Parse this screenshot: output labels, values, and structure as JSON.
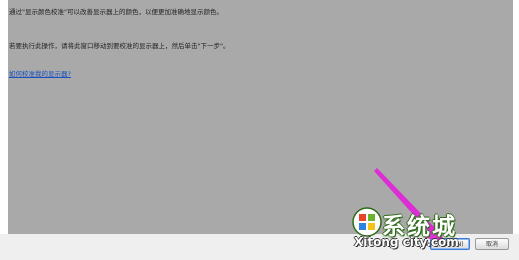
{
  "instructions": {
    "line1": "通过\"显示颜色校准\"可以改善显示器上的颜色，以便更加准确地显示颜色。",
    "line2": "若要执行此操作，请将此窗口移动到要校准的显示器上，然后单击\"下一步\"。",
    "help_link": "如何校准我的显示器?"
  },
  "buttons": {
    "next": "下一步(N)",
    "cancel": "取消"
  },
  "watermark": {
    "chinese": "系统城",
    "english": "Xitong city.com"
  },
  "colors": {
    "panel": "#a9a9a9",
    "arrow": "#e21fd8",
    "next_border": "#3b7bd6",
    "link": "#1a4fc0"
  }
}
